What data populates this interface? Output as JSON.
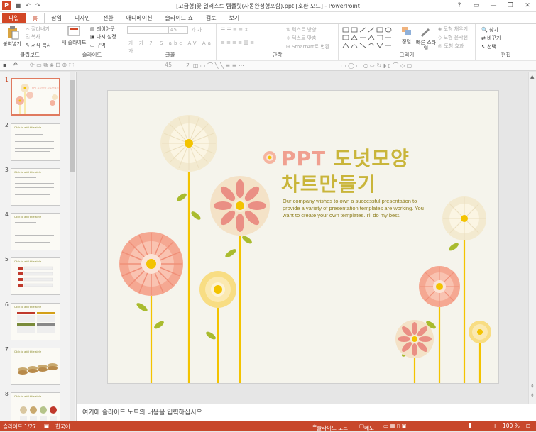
{
  "window": {
    "title": "[고급형]꽃 일러스트 템플릿(자동완성형포함).ppt [호환 모드] - PowerPoint",
    "app_icon": "P",
    "controls": [
      "?",
      "▭",
      "—",
      "❐",
      "✕"
    ]
  },
  "tabs": [
    "파일",
    "홈",
    "삽입",
    "디자인",
    "전환",
    "애니메이션",
    "슬라이드 쇼",
    "검토",
    "보기"
  ],
  "ribbon": {
    "clipboard": {
      "paste": "붙여넣기",
      "cut": "잘라내기",
      "copy": "복사",
      "format_painter": "서식 복사",
      "label": "클립보드"
    },
    "slides": {
      "new_slide": "새 슬라이드",
      "layout": "레이아웃",
      "reset": "다시 설정",
      "section": "구역",
      "label": "슬라이드"
    },
    "font": {
      "size": "45",
      "label": "글꼴"
    },
    "paragraph": {
      "text_direction": "텍스트 방향",
      "align_text": "텍스트 맞춤",
      "smartart": "SmartArt로 변환",
      "label": "단락"
    },
    "drawing": {
      "arrange": "정렬",
      "quick_styles": "빠른 스타일",
      "shape_fill": "도형 채우기",
      "shape_outline": "도형 윤곽선",
      "shape_effects": "도형 효과",
      "label": "그리기"
    },
    "editing": {
      "find": "찾기",
      "replace": "바꾸기",
      "select": "선택",
      "label": "편집"
    }
  },
  "format_bar": {
    "font_size": "45"
  },
  "thumbnails": [
    {
      "num": "1",
      "title": "PPT 도넛모양 차트만들기"
    },
    {
      "num": "2",
      "title": "Click to add title style"
    },
    {
      "num": "3",
      "title": "Click to add title style"
    },
    {
      "num": "4",
      "title": "Click to add title style"
    },
    {
      "num": "5",
      "title": "Click to add title style"
    },
    {
      "num": "6",
      "title": "Click to add title style"
    },
    {
      "num": "7",
      "title": "Click to add title style"
    },
    {
      "num": "8",
      "title": "Click to add title style"
    }
  ],
  "slide": {
    "title_ppt": "PPT",
    "title_rest": "도넛모양",
    "title_line2": "차트만들기",
    "body": "Our company wishes to own a successful presentation to provide a variety of presentation templates are working. You want to create your own templates. I'll do my best.",
    "colors": {
      "pink": "#f0a090",
      "yellow": "#c9b53a",
      "text": "#8d7d1c"
    }
  },
  "notes_placeholder": "여기에 슬라이드 노트의 내용을 입력하십시오",
  "status": {
    "slide_count": "슬라이드 1/27",
    "language": "한국어",
    "slide_notes": "슬라이드 노트",
    "notes_label": "메모",
    "zoom": "100 %"
  }
}
